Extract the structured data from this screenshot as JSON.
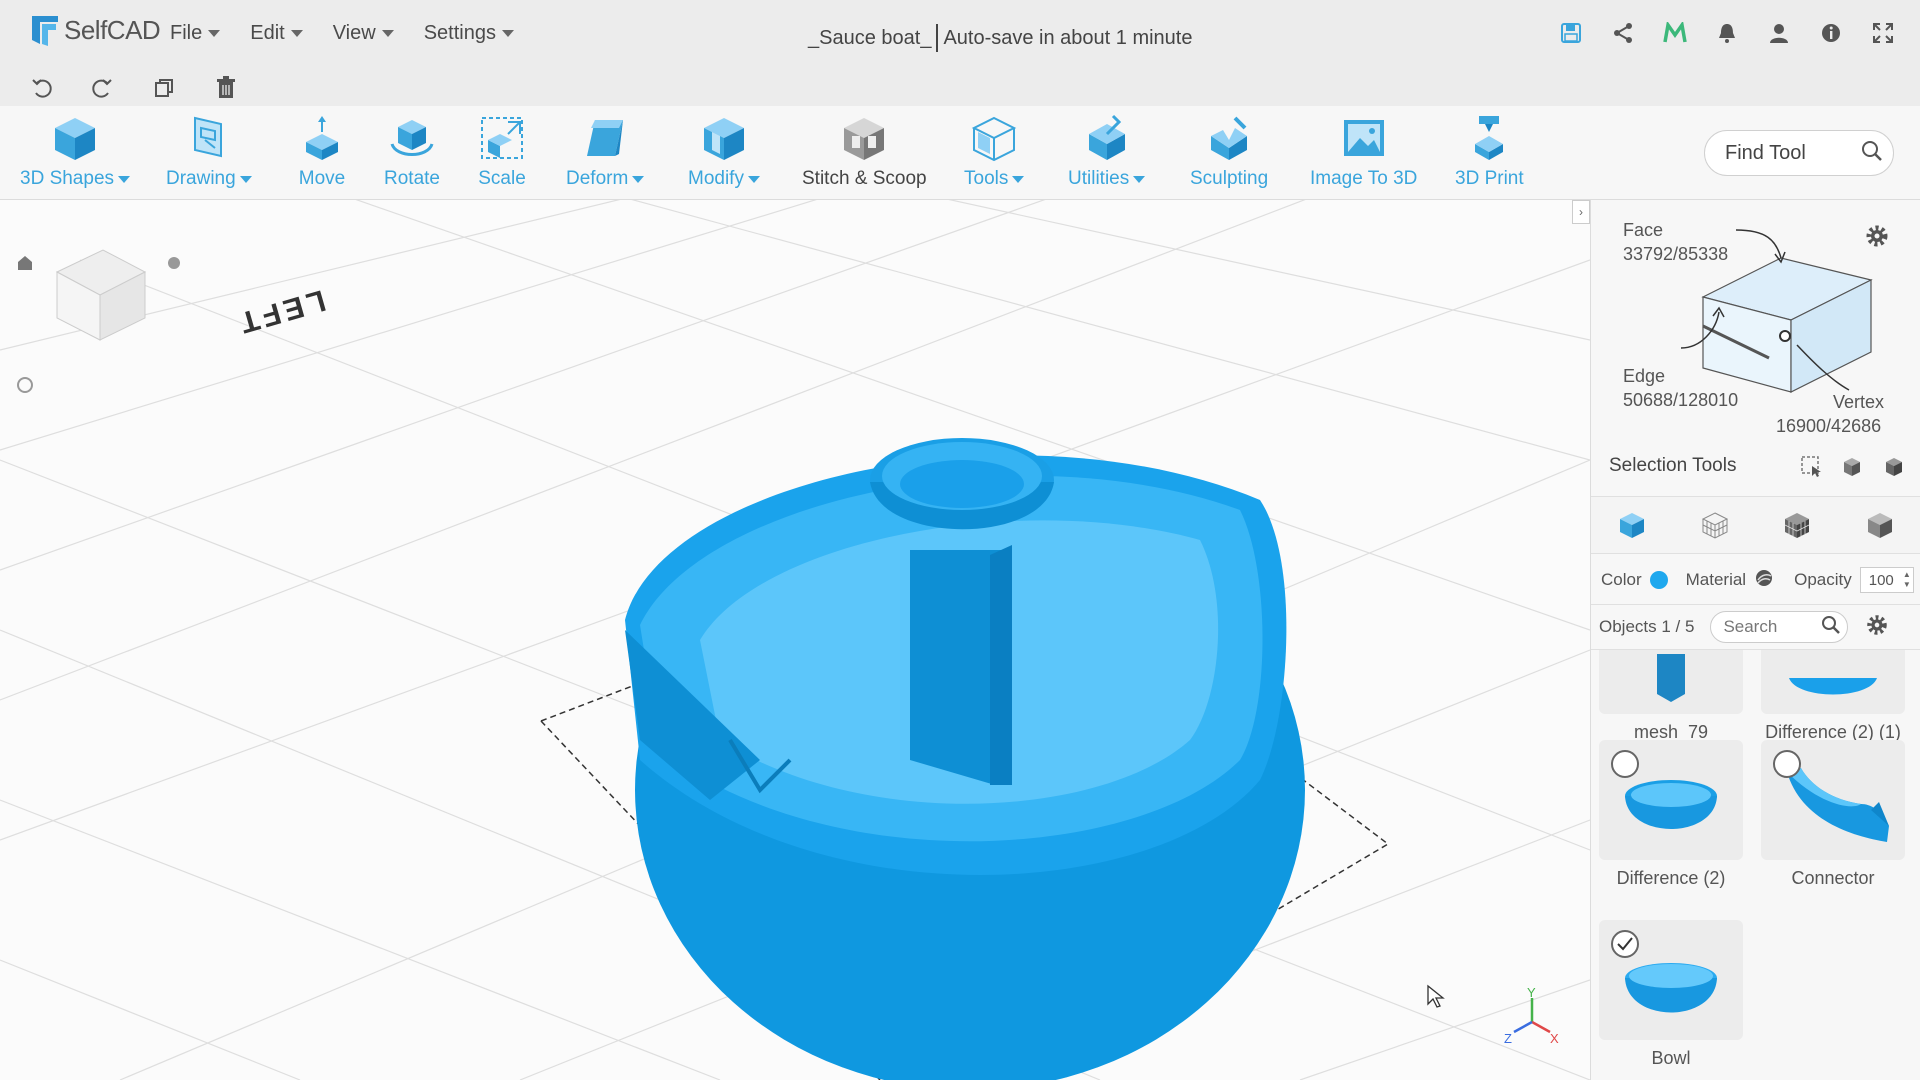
{
  "app": {
    "brand": "SelfCAD"
  },
  "menus": [
    {
      "label": "File"
    },
    {
      "label": "Edit"
    },
    {
      "label": "View"
    },
    {
      "label": "Settings"
    }
  ],
  "document": {
    "title": "_Sauce boat_",
    "autosave": "Auto-save in about 1 minute"
  },
  "top_icons": [
    "save-icon",
    "share-icon",
    "m-logo-icon",
    "bell-icon",
    "user-icon",
    "info-icon",
    "fullscreen-icon"
  ],
  "quickbar": [
    "undo-icon",
    "redo-icon",
    "copy-icon",
    "trash-icon"
  ],
  "tools": [
    {
      "label": "3D Shapes",
      "caret": true
    },
    {
      "label": "Drawing",
      "caret": true
    },
    {
      "label": "Move",
      "caret": false
    },
    {
      "label": "Rotate",
      "caret": false
    },
    {
      "label": "Scale",
      "caret": false
    },
    {
      "label": "Deform",
      "caret": true
    },
    {
      "label": "Modify",
      "caret": true
    },
    {
      "label": "Stitch & Scoop",
      "caret": false
    },
    {
      "label": "Tools",
      "caret": true
    },
    {
      "label": "Utilities",
      "caret": true
    },
    {
      "label": "Sculpting",
      "caret": false
    },
    {
      "label": "Image To 3D",
      "caret": false
    },
    {
      "label": "3D Print",
      "caret": false
    }
  ],
  "find_tool": {
    "placeholder": "Find Tool"
  },
  "viewcube": {
    "orientation_label": "LEFT"
  },
  "selection": {
    "face_label": "Face",
    "face_value": "33792/85338",
    "edge_label": "Edge",
    "edge_value": "50688/128010",
    "vertex_label": "Vertex",
    "vertex_value": "16900/42686",
    "tools_label": "Selection Tools"
  },
  "properties": {
    "color_label": "Color",
    "color": "#1fa8ee",
    "material_label": "Material",
    "opacity_label": "Opacity",
    "opacity_value": "100"
  },
  "objects": {
    "count_label": "Objects 1 / 5",
    "search_placeholder": "Search",
    "items": [
      {
        "name": "mesh_79",
        "selected": false
      },
      {
        "name": "Difference (2) (1)",
        "selected": false
      },
      {
        "name": "Difference (2)",
        "selected": false
      },
      {
        "name": "Connector",
        "selected": false
      },
      {
        "name": "Bowl",
        "selected": true
      }
    ]
  },
  "colors": {
    "accent": "#3aa5dc",
    "model": "#1fa8ee"
  }
}
